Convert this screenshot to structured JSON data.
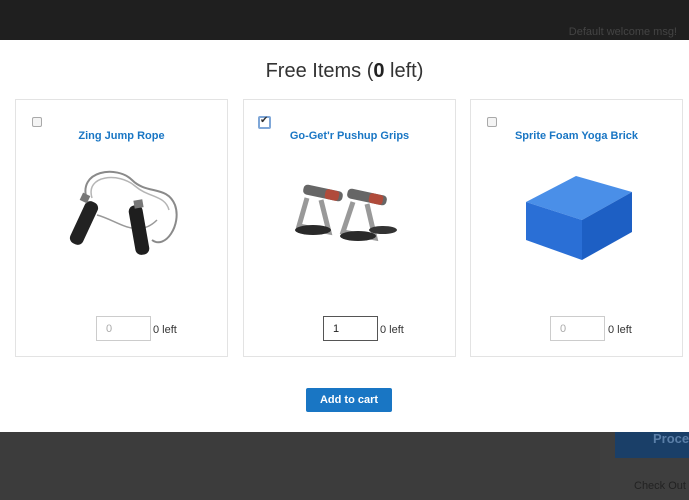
{
  "header": {
    "welcome": "Default welcome msg!"
  },
  "modal": {
    "title_prefix": "Free Items (",
    "title_count": "0",
    "title_suffix": " left)",
    "add_button": "Add to cart"
  },
  "items": [
    {
      "name": "Zing Jump Rope",
      "checked": false,
      "qty_placeholder": "0",
      "qty_value": "",
      "left": "0 left",
      "icon": "jump-rope"
    },
    {
      "name": "Go-Get'r Pushup Grips",
      "checked": true,
      "qty_placeholder": "",
      "qty_value": "1",
      "left": "0 left",
      "icon": "pushup-grips"
    },
    {
      "name": "Sprite Foam Yoga Brick",
      "checked": false,
      "qty_placeholder": "0",
      "qty_value": "",
      "left": "0 left",
      "icon": "yoga-brick"
    }
  ],
  "background": {
    "proceed": "Proce",
    "checkout": "Check Out"
  }
}
